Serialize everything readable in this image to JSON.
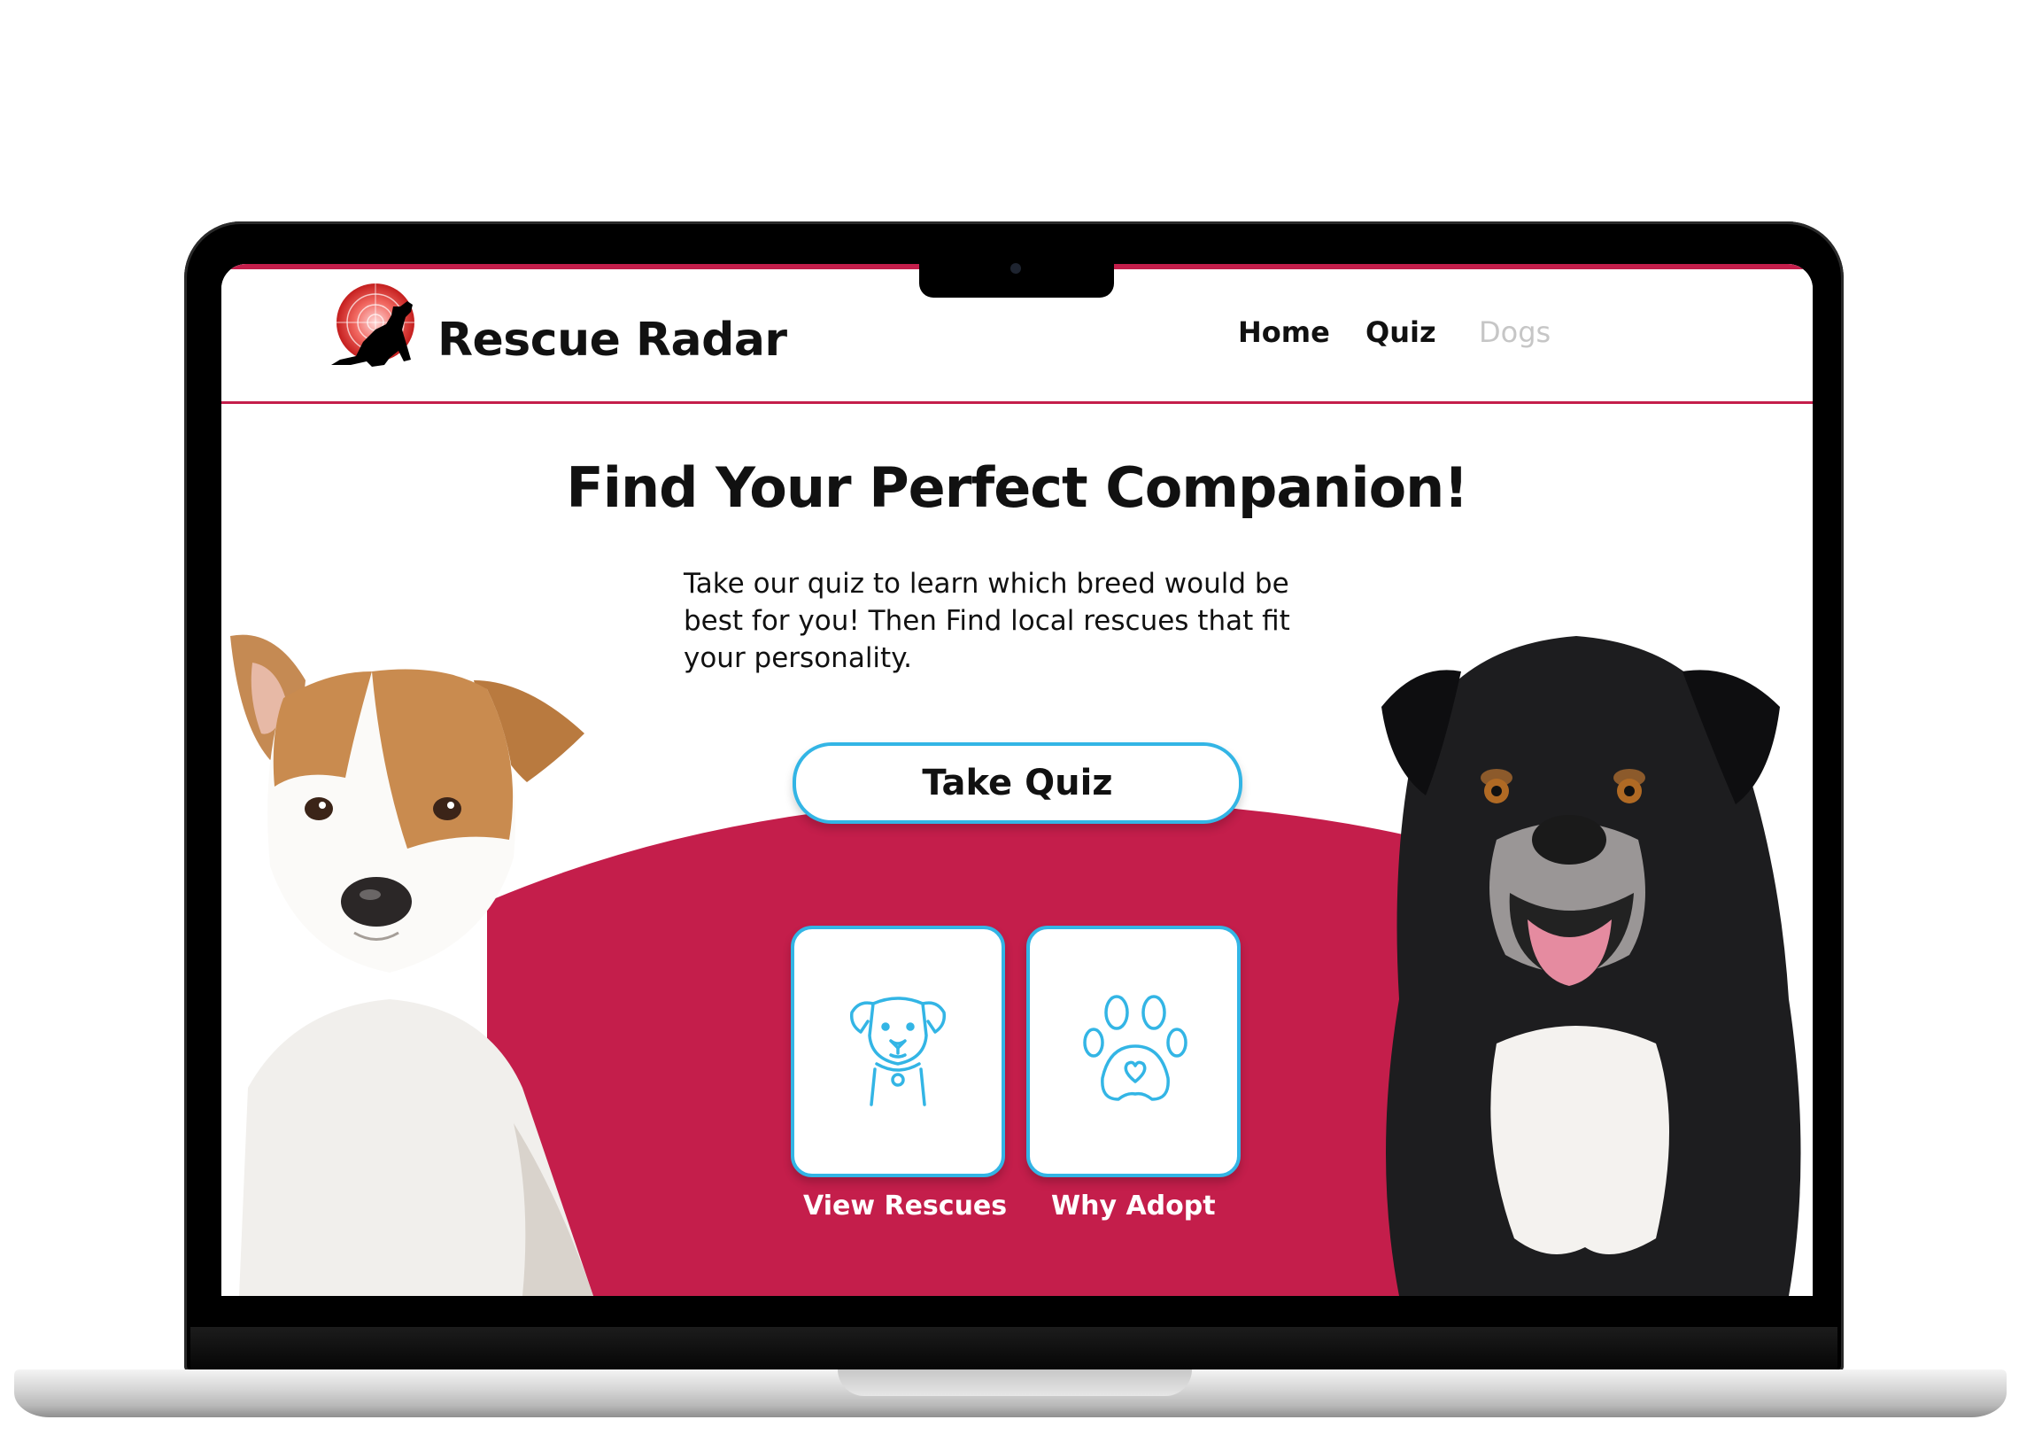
{
  "app": {
    "brand_name": "Rescue Radar",
    "accent_color": "#c41e4b",
    "button_border_color": "#33b5e5"
  },
  "nav": {
    "items": [
      {
        "label": "Home"
      },
      {
        "label": "Quiz"
      },
      {
        "label": "Dogs"
      }
    ]
  },
  "hero": {
    "title": "Find Your Perfect Companion!",
    "description": "Take our quiz to learn which breed would be best for you! Then Find local rescues that fit your personality.",
    "cta_label": "Take Quiz"
  },
  "cards": [
    {
      "label": "View Rescues",
      "icon": "dog-head-icon"
    },
    {
      "label": "Why Adopt",
      "icon": "paw-heart-icon"
    }
  ],
  "images": {
    "left_dog": "tan-and-white-terrier-photo",
    "right_dog": "black-and-white-shepherd-photo"
  }
}
